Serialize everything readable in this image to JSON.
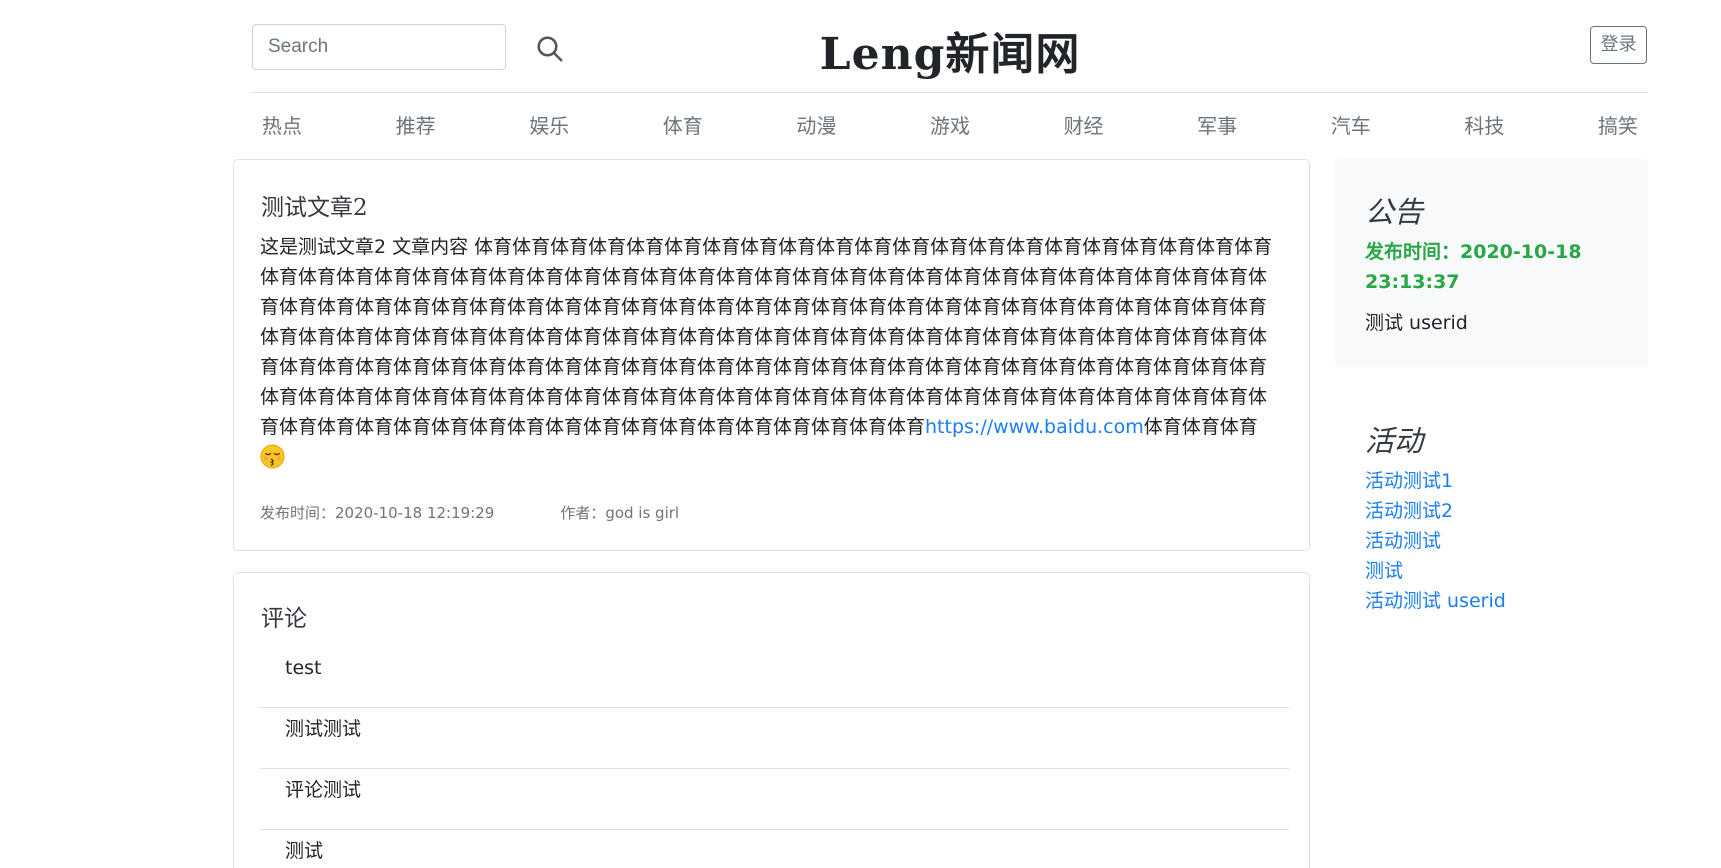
{
  "header": {
    "search_placeholder": "Search",
    "search_icon": "search-icon",
    "site_title": "Leng新闻网",
    "login_label": "登录"
  },
  "nav": {
    "items": [
      "热点",
      "推荐",
      "娱乐",
      "体育",
      "动漫",
      "游戏",
      "财经",
      "军事",
      "汽车",
      "科技",
      "搞笑"
    ]
  },
  "article": {
    "title": "测试文章2",
    "body_text": "这是测试文章2 文章内容 体育体育体育体育体育体育体育体育体育体育体育体育体育体育体育体育体育体育体育体育体育体育体育体育体育体育体育体育体育体育体育体育体育体育体育体育体育体育体育体育体育体育体育体育体育体育体育体育体育体育体育体育体育体育体育体育体育体育体育体育体育体育体育体育体育体育体育体育体育体育体育体育体育体育体育体育体育体育体育体育体育体育体育体育体育体育体育体育体育体育体育体育体育体育体育体育体育体育体育体育体育体育体育体育体育体育体育体育体育体育体育体育体育体育体育体育体育体育体育体育体育体育体育体育体育体育体育体育体育体育体育体育体育体育体育体育体育体育体育体育体育体育体育体育体育体育体育体育体育体育体育体育体育体育体育体育体育体育体育体育体育体育体育体育体育体育体育体育体育体育体育",
    "link_text": "https://www.baidu.com",
    "tail_text": "体育体育体育",
    "emoji_icon": "kissing-face-emoji-icon",
    "publish_time": "发布时间：2020-10-18 12:19:29",
    "author": "作者：god is girl"
  },
  "comments": {
    "title": "评论",
    "items": [
      "test",
      "测试测试",
      "评论测试",
      "测试"
    ]
  },
  "sidebar": {
    "notice_title": "公告",
    "notice_time": "发布时间：2020-10-18 23:13:37",
    "notice_text": "测试 userid",
    "activity_title": "活动",
    "activities": [
      "活动测试1",
      "活动测试2",
      "活动测试",
      "测试",
      "活动测试 userid"
    ]
  },
  "colors": {
    "link": "#1a7ef2",
    "notice_time": "#28a745",
    "muted": "#6c757d"
  }
}
